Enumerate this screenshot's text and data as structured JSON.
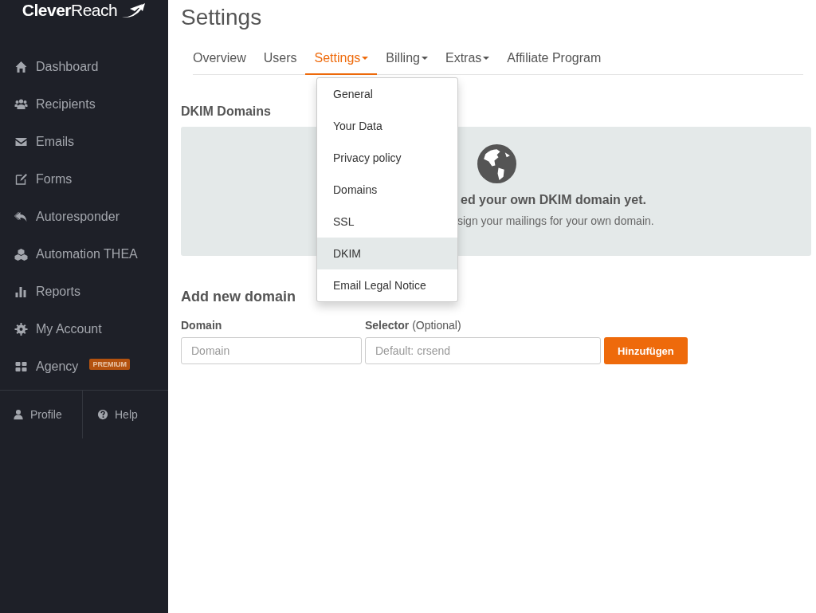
{
  "sidebar": {
    "logo": "**Clever**Reach",
    "items": [
      {
        "label": "Dashboard"
      },
      {
        "label": "Recipients"
      },
      {
        "label": "Emails"
      },
      {
        "label": "Forms"
      },
      {
        "label": "Autoresponder"
      },
      {
        "label": "Automation THEA"
      },
      {
        "label": "Reports"
      },
      {
        "label": "My Account"
      },
      {
        "label": "Agency",
        "badge": "PREMIUM"
      }
    ],
    "footer": [
      {
        "label": "Profile"
      },
      {
        "label": "Help"
      }
    ]
  },
  "page": {
    "title": "Settings",
    "tabs": [
      {
        "label": "Overview",
        "selected": false,
        "dropdown": false
      },
      {
        "label": "Users",
        "selected": false,
        "dropdown": false
      },
      {
        "label": "Settings",
        "selected": true,
        "dropdown": true
      },
      {
        "label": "Billing",
        "selected": false,
        "dropdown": true
      },
      {
        "label": "Extras",
        "selected": false,
        "dropdown": true
      },
      {
        "label": "Affiliate Program",
        "selected": false,
        "dropdown": false
      }
    ],
    "menu": [
      {
        "label": "General",
        "selected": false
      },
      {
        "label": "Your Data",
        "selected": false
      },
      {
        "label": "Privacy policy",
        "selected": false
      },
      {
        "label": "Domains",
        "selected": false
      },
      {
        "label": "SSL",
        "selected": false
      },
      {
        "label": "DKIM",
        "selected": true
      },
      {
        "label": "Email Legal Notice",
        "selected": false
      }
    ],
    "section_title": "DKIM Domains",
    "empty_state": {
      "title": "ed your own DKIM domain yet.",
      "text": "sign your mailings for your own domain."
    },
    "form_title": "Add new domain",
    "fields": [
      {
        "label": "Domain",
        "placeholder": "Domain"
      },
      {
        "label": "**Selector** (Optional)",
        "placeholder": "Default: crsend"
      }
    ],
    "submit": "Hinzufügen"
  }
}
